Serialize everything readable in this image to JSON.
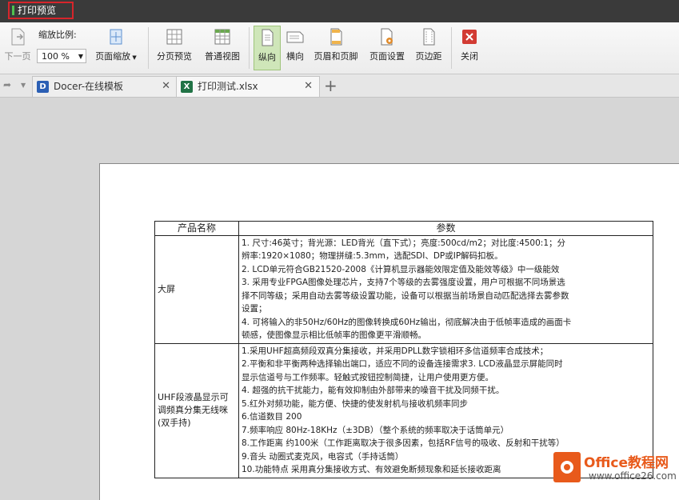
{
  "app": {
    "title": "打印预览"
  },
  "toolbar": {
    "prev_page": "下一页",
    "zoom_label": "缩放比例:",
    "zoom_value": "100 %",
    "page_zoom": "页面缩放",
    "page_preview": "分页预览",
    "normal_view": "普通视图",
    "portrait": "纵向",
    "landscape": "横向",
    "header_footer": "页眉和页脚",
    "page_setup": "页面设置",
    "page_margin": "页边距",
    "close": "关闭"
  },
  "tabs": [
    {
      "label": "Docer-在线模板",
      "icon": "docer-icon"
    },
    {
      "label": "打印测试.xlsx",
      "icon": "excel-icon"
    }
  ],
  "table": {
    "headers": [
      "产品名称",
      "参数"
    ],
    "rows": [
      {
        "name": "大屏",
        "lines": [
          "1. 尺寸:46英寸；背光源：LED背光（直下式）；亮度:500cd/m2；对比度:4500:1；分",
          "辨率:1920×1080；物理拼缝:5.3mm，选配SDI、DP或IP解码扣板。",
          "2. LCD单元符合GB21520-2008《计算机显示器能效限定值及能效等级》中一级能效",
          "3. 采用专业FPGA图像处理芯片，支持7个等级的去雾强度设置，用户可根据不同场景选",
          "择不同等级；采用自动去雾等级设置功能，设备可以根据当前场景自动匹配选择去雾参数",
          "设置；",
          "4. 可将输入的非50Hz/60Hz的图像转换成60Hz输出，彻底解决由于低帧率造成的画面卡",
          "顿感，使图像显示相比低帧率的图像更平滑顺畅。"
        ]
      },
      {
        "name": "UHF段液晶显示可调频真分集无线咪(双手持)",
        "lines": [
          "1.采用UHF超高频段双真分集接收，并采用DPLL数字锁相环多信道频率合成技术；",
          "2.平衡和非平衡两种选择输出端口，适应不同的设备连接需求3. LCD液晶显示屏能同时",
          "显示信道号与工作频率。轻触式按钮控制简捷，让用户使用更方便。",
          "4. 超强的抗干扰能力，能有效抑制由外部带来的噪音干扰及同频干扰。",
          "5.红外对频功能，能方便、快捷的使发射机与接收机频率同步",
          "6.信道数目 200",
          "7.频率响应 80Hz-18KHz（±3DB）（整个系统的频率取决于话筒单元）",
          "8.工作距离 约100米（工作距离取决于很多因素，包括RF信号的吸收、反射和干扰等）",
          "9.音头 动圈式麦克风，电容式（手持话筒）",
          "10.功能特点 采用真分集接收方式、有效避免断频现象和延长接收距离"
        ]
      }
    ]
  },
  "watermark": {
    "line1": "Office教程网",
    "line2": "www.office26.com"
  },
  "colors": {
    "active_tab_border": "#d6252b",
    "portrait_active": "#cfe6b9",
    "watermark": "#e85a1b"
  }
}
